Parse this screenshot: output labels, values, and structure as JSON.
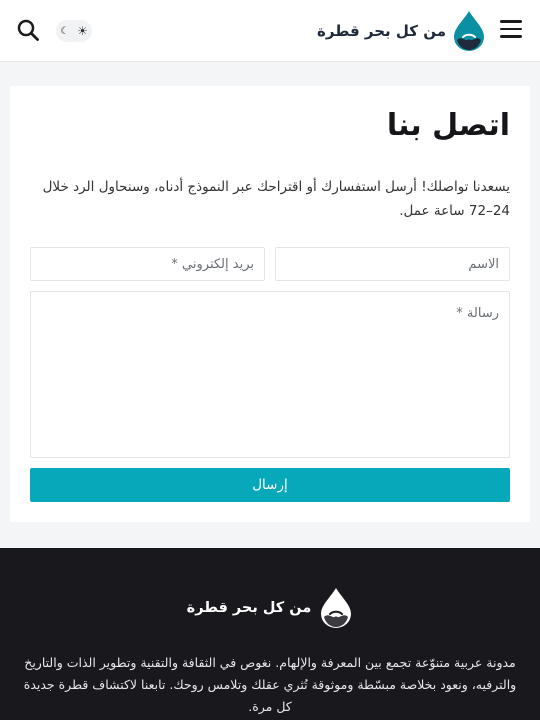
{
  "header": {
    "logo_text": "من كل بحر قطرة",
    "theme_toggle_moon": "☾",
    "theme_toggle_sun": "☀",
    "icons": {
      "menu": "hamburger-menu-icon",
      "search": "search-icon",
      "logo": "water-drop-logo-icon"
    }
  },
  "contact": {
    "title": "اتصل بنا",
    "intro": "يسعدنا تواصلك! أرسل استفسارك أو اقتراحك عبر النموذج أدناه، وسنحاول الرد خلال 24–72 ساعة عمل.",
    "name_placeholder": "الاسم",
    "email_placeholder": "بريد إلكتروني *",
    "message_placeholder": "رسالة *",
    "submit_label": "إرسال"
  },
  "footer": {
    "logo_text": "من كل بحر قطرة",
    "description": "مدونة عربية متنوّعة تجمع بين المعرفة والإلهام. نغوص في الثقافة والتقنية وتطوير الذات والتاريخ والترفيه، ونعود بخلاصة مبسّطة وموثوقة تُثري عقلك وتلامس روحك. تابعنا لاكتشاف قطرة جديدة كل مرة."
  },
  "colors": {
    "accent": "#07a8b9",
    "logo_dark": "#1f2b3c",
    "logo_teal": "#0b8fa3",
    "footer_bg": "#19191d"
  }
}
